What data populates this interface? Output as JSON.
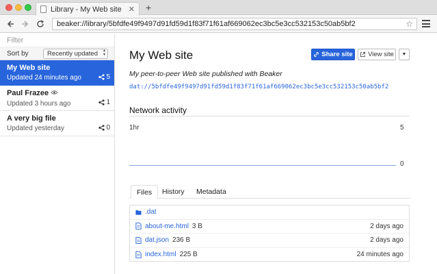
{
  "tab": {
    "title": "Library - My Web site",
    "new_tab": "+"
  },
  "nav": {
    "url": "beaker://library/5bfdfe49f9497d91fd59d1f83f71f61af669062ec3bc5e3cc532153c50ab5bf2"
  },
  "sidebar": {
    "filter_placeholder": "Filter",
    "sort_label": "Sort by",
    "sort_value": "Recently updated",
    "sites": [
      {
        "title": "My Web site",
        "meta": "Updated 24 minutes ago",
        "peers": "5",
        "active": true
      },
      {
        "title": "Paul Frazee",
        "meta": "Updated 3 hours ago",
        "peers": "1",
        "active": false,
        "watched": true
      },
      {
        "title": "A very big file",
        "meta": "Updated yesterday",
        "peers": "0",
        "active": false
      }
    ]
  },
  "main": {
    "title": "My Web site",
    "share_label": "Share site",
    "view_label": "View site",
    "description": "My peer-to-peer Web site published with Beaker",
    "dat_url": "dat://5bfdfe49f9497d91fd59d1f83f71f61af669062ec3bc5e3cc532153c50ab5bf2",
    "network_heading": "Network activity",
    "graph": {
      "range_label": "1hr",
      "max": "5",
      "min": "0"
    },
    "tabs": [
      "Files",
      "History",
      "Metadata"
    ],
    "files": [
      {
        "name": ".dat",
        "size": "",
        "date": "",
        "type": "folder"
      },
      {
        "name": "about-me.html",
        "size": "3 B",
        "date": "2 days ago",
        "type": "file"
      },
      {
        "name": "dat.json",
        "size": "236 B",
        "date": "2 days ago",
        "type": "file"
      },
      {
        "name": "index.html",
        "size": "225 B",
        "date": "24 minutes ago",
        "type": "file"
      }
    ]
  },
  "colors": {
    "accent": "#2864dc"
  }
}
